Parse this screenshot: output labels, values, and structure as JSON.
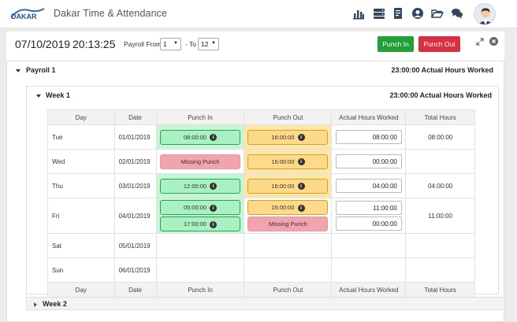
{
  "header": {
    "app_title": "Dakar Time & Attendance",
    "logo_text": "DAKAR",
    "icons": [
      "bar-chart-icon",
      "server-icon",
      "document-icon",
      "user-circle-icon",
      "folder-open-icon",
      "chat-icon"
    ]
  },
  "toolbar": {
    "date": "07/10/2019",
    "time": "20:13:25",
    "payroll_from_label": "Payroll From",
    "payroll_from_value": "1",
    "to_label": "- To",
    "payroll_to_value": "12",
    "punch_in_label": "Punch In",
    "punch_out_label": "Punch Out"
  },
  "payroll": {
    "title": "Payroll 1",
    "total": "23:00:00 Actual Hours Worked"
  },
  "week1": {
    "title": "Week 1",
    "total": "23:00:00 Actual Hours Worked"
  },
  "week2": {
    "title": "Week 2"
  },
  "table": {
    "headers": [
      "Day",
      "Date",
      "Punch In",
      "Punch Out",
      "Actual Hours Worked",
      "Total Hours"
    ],
    "rows": [
      {
        "day": "Tue",
        "date": "01/01/2019",
        "punch_in": "08:00:00",
        "punch_out": "16:00:00",
        "actual": "08:00:00",
        "total": "08:00:00"
      },
      {
        "day": "Wed",
        "date": "02/01/2019",
        "punch_in": "Missing Punch",
        "punch_out": "16:00:00",
        "actual": "00:00:00",
        "total": ""
      },
      {
        "day": "Thu",
        "date": "03/01/2019",
        "punch_in": "12:00:00",
        "punch_out": "16:00:00",
        "actual": "04:00:00",
        "total": "04:00:00"
      },
      {
        "day": "Fri",
        "date": "04/01/2019",
        "punch_in": "05:00:00",
        "punch_in_2": "17:00:00",
        "punch_out": "16:00:00",
        "punch_out_2": "Missing Punch",
        "actual": "11:00:00",
        "actual_2": "00:00:00",
        "total": "11:00:00"
      },
      {
        "day": "Sat",
        "date": "05/01/2019"
      },
      {
        "day": "Sun",
        "date": "06/01/2019"
      }
    ]
  }
}
